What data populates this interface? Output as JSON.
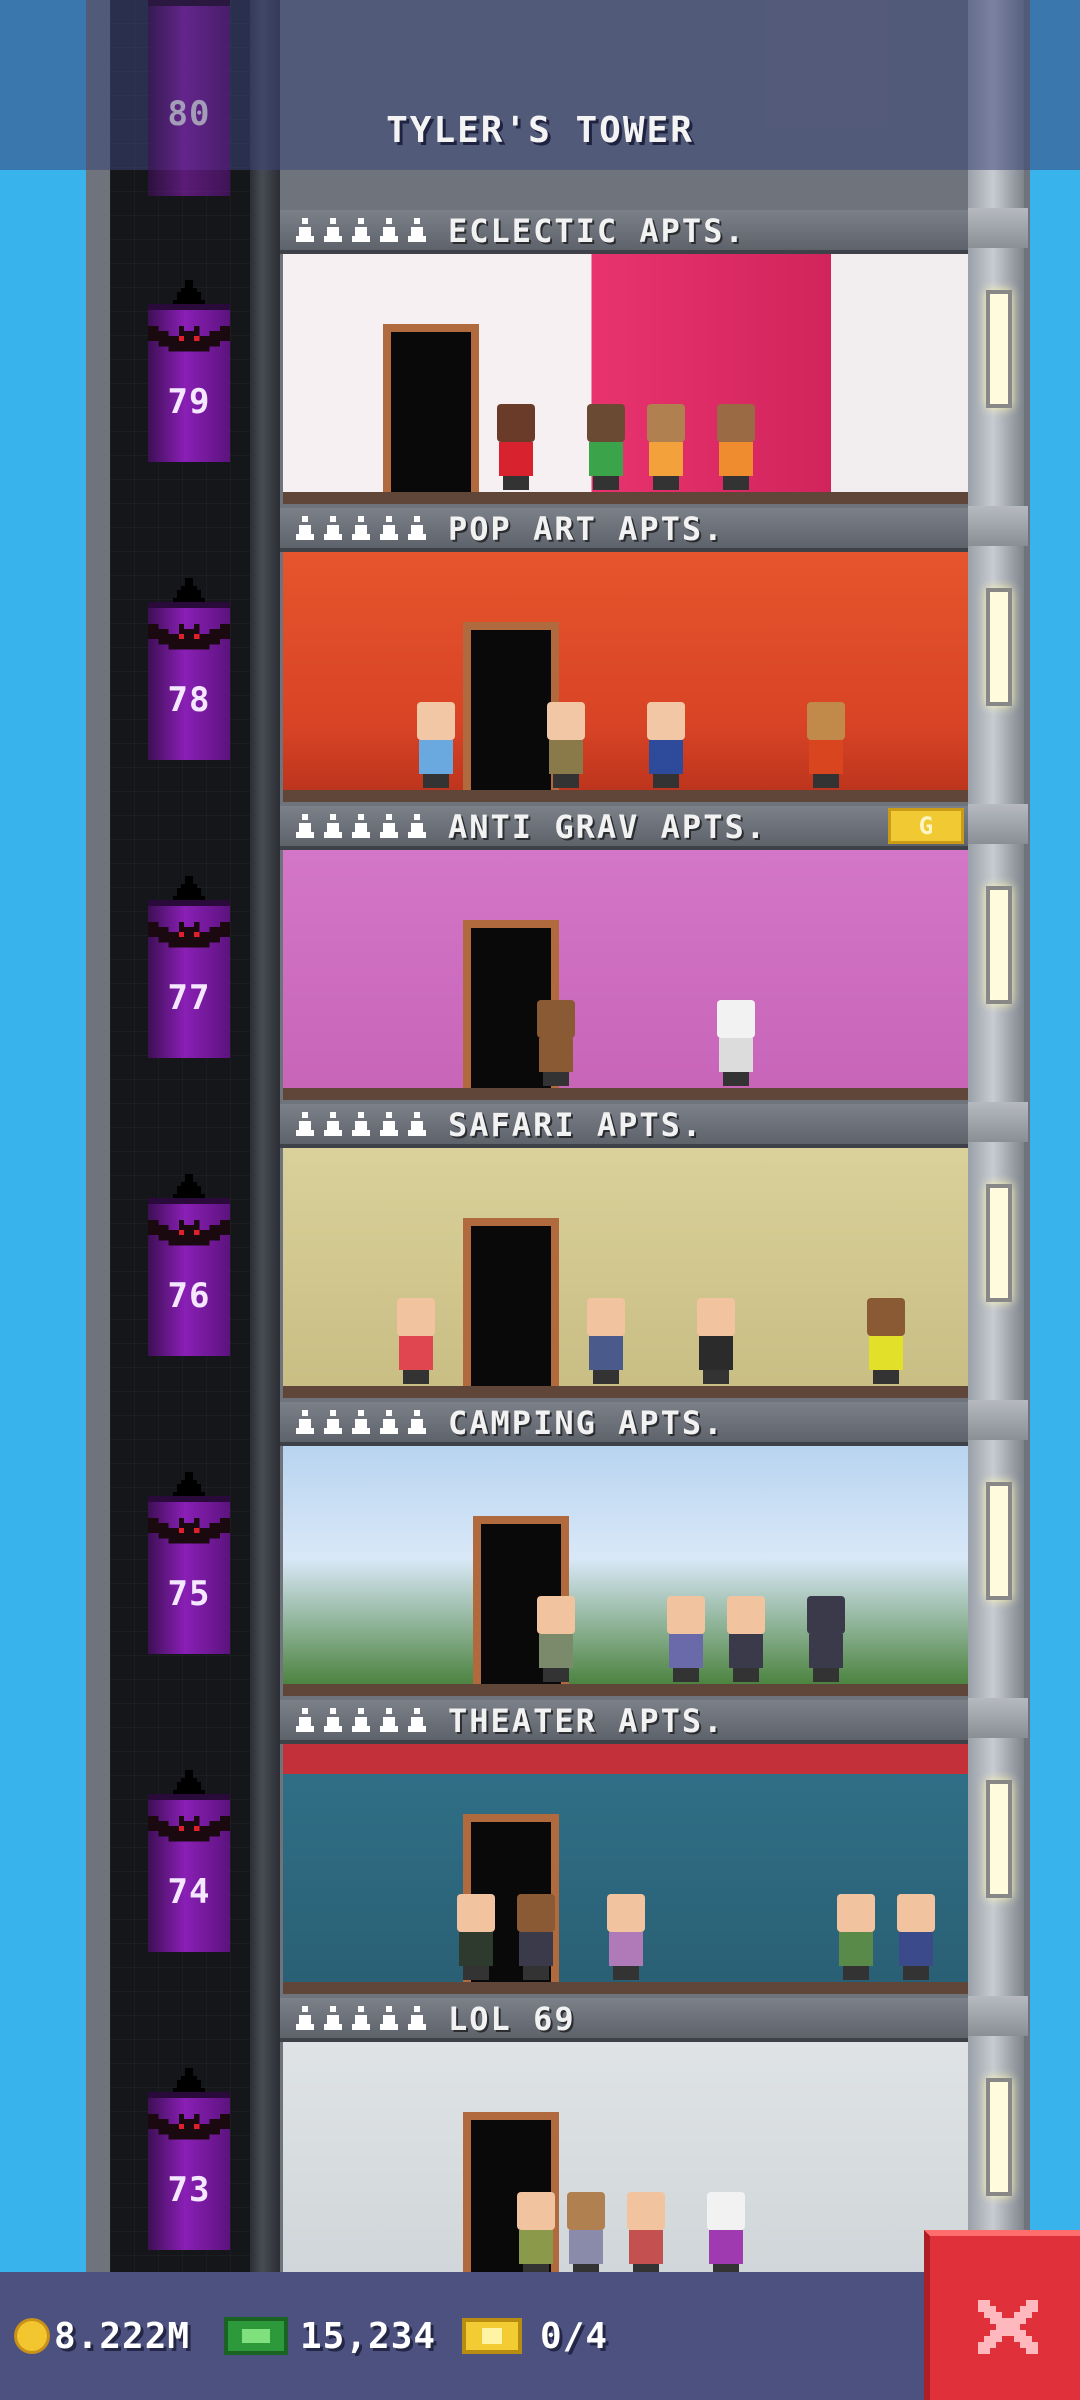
{
  "tower": {
    "title": "TYLER'S TOWER"
  },
  "colors": {
    "sky": "#38b3ec",
    "elevator_car": "#8a1fb6",
    "close_button": "#e0303a",
    "status_bar": "#4c5180"
  },
  "top_partial_floor": {
    "number": "80"
  },
  "floors": [
    {
      "number": "79",
      "name": "ECLECTIC APTS.",
      "stars": 5,
      "badge": ""
    },
    {
      "number": "78",
      "name": "POP ART APTS.",
      "stars": 5,
      "badge": ""
    },
    {
      "number": "77",
      "name": "ANTI GRAV APTS.",
      "stars": 5,
      "badge": "G"
    },
    {
      "number": "76",
      "name": "SAFARI APTS.",
      "stars": 5,
      "badge": ""
    },
    {
      "number": "75",
      "name": "CAMPING APTS.",
      "stars": 5,
      "badge": ""
    },
    {
      "number": "74",
      "name": "THEATER APTS.",
      "stars": 5,
      "badge": ""
    },
    {
      "number": "73",
      "name": "LOL 69",
      "stars": 5,
      "badge": ""
    }
  ],
  "status": {
    "coins": "8.222M",
    "bux": "15,234",
    "tickets": "0/4",
    "coin_icon": "coin-icon",
    "bux_icon": "bux-icon",
    "ticket_icon": "golden-ticket-icon",
    "close_icon": "close-icon"
  }
}
